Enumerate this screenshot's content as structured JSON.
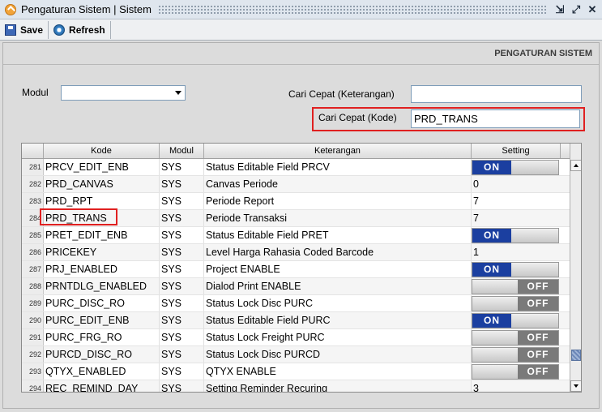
{
  "window": {
    "title": "Pengaturan Sistem | Sistem"
  },
  "toolbar": {
    "save_label": "Save",
    "refresh_label": "Refresh"
  },
  "panel": {
    "header": "PENGATURAN SISTEM"
  },
  "form": {
    "modul_label": "Modul",
    "modul_value": "",
    "cari_keterangan_label": "Cari Cepat (Keterangan)",
    "cari_keterangan_value": "",
    "cari_kode_label": "Cari Cepat (Kode)",
    "cari_kode_value": "PRD_TRANS"
  },
  "grid": {
    "columns": [
      "Kode",
      "Modul",
      "Keterangan",
      "Setting"
    ],
    "rows": [
      {
        "no": "281",
        "kode": "PRCV_EDIT_ENB",
        "modul": "SYS",
        "keterangan": "Status Editable Field PRCV",
        "setting_type": "toggle",
        "setting": "ON"
      },
      {
        "no": "282",
        "kode": "PRD_CANVAS",
        "modul": "SYS",
        "keterangan": "Canvas Periode",
        "setting_type": "text",
        "setting": "0"
      },
      {
        "no": "283",
        "kode": "PRD_RPT",
        "modul": "SYS",
        "keterangan": "Periode Report",
        "setting_type": "text",
        "setting": "7"
      },
      {
        "no": "284",
        "kode": "PRD_TRANS",
        "modul": "SYS",
        "keterangan": "Periode Transaksi",
        "setting_type": "text",
        "setting": "7"
      },
      {
        "no": "285",
        "kode": "PRET_EDIT_ENB",
        "modul": "SYS",
        "keterangan": "Status Editable Field PRET",
        "setting_type": "toggle",
        "setting": "ON"
      },
      {
        "no": "286",
        "kode": "PRICEKEY",
        "modul": "SYS",
        "keterangan": "Level Harga Rahasia Coded Barcode",
        "setting_type": "text",
        "setting": "1"
      },
      {
        "no": "287",
        "kode": "PRJ_ENABLED",
        "modul": "SYS",
        "keterangan": "Project ENABLE",
        "setting_type": "toggle",
        "setting": "ON"
      },
      {
        "no": "288",
        "kode": "PRNTDLG_ENABLED",
        "modul": "SYS",
        "keterangan": "Dialod Print ENABLE",
        "setting_type": "toggle",
        "setting": "OFF"
      },
      {
        "no": "289",
        "kode": "PURC_DISC_RO",
        "modul": "SYS",
        "keterangan": "Status Lock Disc PURC",
        "setting_type": "toggle",
        "setting": "OFF"
      },
      {
        "no": "290",
        "kode": "PURC_EDIT_ENB",
        "modul": "SYS",
        "keterangan": "Status Editable Field PURC",
        "setting_type": "toggle",
        "setting": "ON"
      },
      {
        "no": "291",
        "kode": "PURC_FRG_RO",
        "modul": "SYS",
        "keterangan": "Status Lock Freight PURC",
        "setting_type": "toggle",
        "setting": "OFF"
      },
      {
        "no": "292",
        "kode": "PURCD_DISC_RO",
        "modul": "SYS",
        "keterangan": "Status Lock Disc PURCD",
        "setting_type": "toggle",
        "setting": "OFF"
      },
      {
        "no": "293",
        "kode": "QTYX_ENABLED",
        "modul": "SYS",
        "keterangan": "QTYX ENABLE",
        "setting_type": "toggle",
        "setting": "OFF"
      },
      {
        "no": "294",
        "kode": "REC_REMIND_DAY",
        "modul": "SYS",
        "keterangan": "Setting Reminder Recuring",
        "setting_type": "text",
        "setting": "3"
      }
    ]
  },
  "colors": {
    "highlight": "#e02020",
    "toggle_on": "#1b3fa0",
    "toggle_off": "#7a7a7a"
  }
}
